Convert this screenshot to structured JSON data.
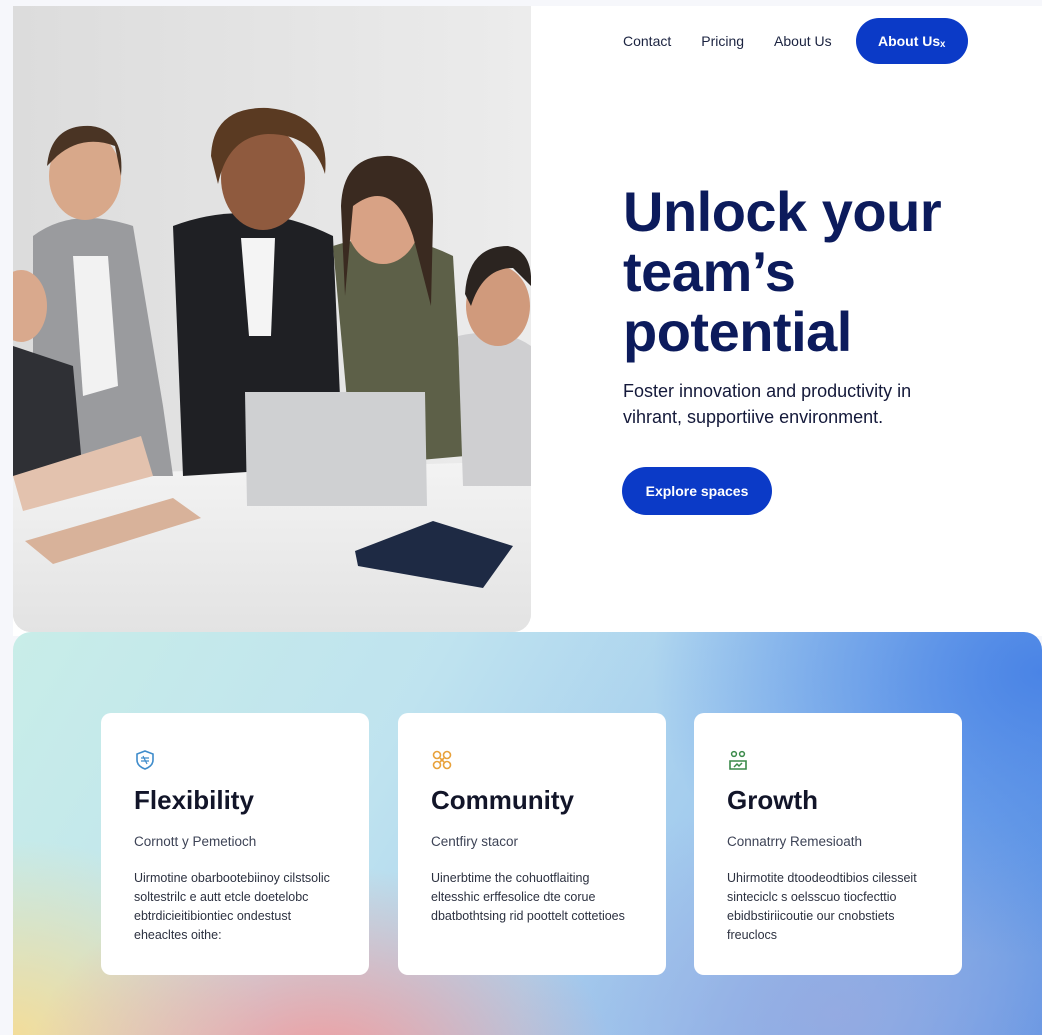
{
  "nav": {
    "links": [
      "Contact",
      "Pricing",
      "About Us"
    ],
    "cta_label": "About Usₓ"
  },
  "hero": {
    "headline": "Unlock your team’s potential",
    "subtext": "Foster innovation and productivity in vihrant, supportiive environment.",
    "button_label": "Explore spaces"
  },
  "features": [
    {
      "icon": "shield-icon",
      "icon_color": "#3f8ccb",
      "title": "Flexibility",
      "subtitle": "Cornott y Pemetioch",
      "body": "Uirmotine obarbootebiinoy cilstsolic soltestrilc e autt etcle doetelobc ebtrdicieitibiontiec ondestust eheacltes oithe:"
    },
    {
      "icon": "community-icon",
      "icon_color": "#e8a13a",
      "title": "Community",
      "subtitle": "Centfiry stacor",
      "body": "Uinerbtime the cohuotflaiting eltesshic erffesolice dte corue dbatbothtsing rid poottelt cottetioes"
    },
    {
      "icon": "growth-icon",
      "icon_color": "#3b8a4a",
      "title": "Growth",
      "subtitle": "Connatrry Remesioath",
      "body": "Uhirmotite dtoodeodtibios cilesseit sinteciclc s oelsscuo tiocfecttio ebidbstiriicoutie our cnobstiets freuclocs"
    }
  ],
  "colors": {
    "primary": "#0b3ac7",
    "headline": "#0c1b5c"
  }
}
